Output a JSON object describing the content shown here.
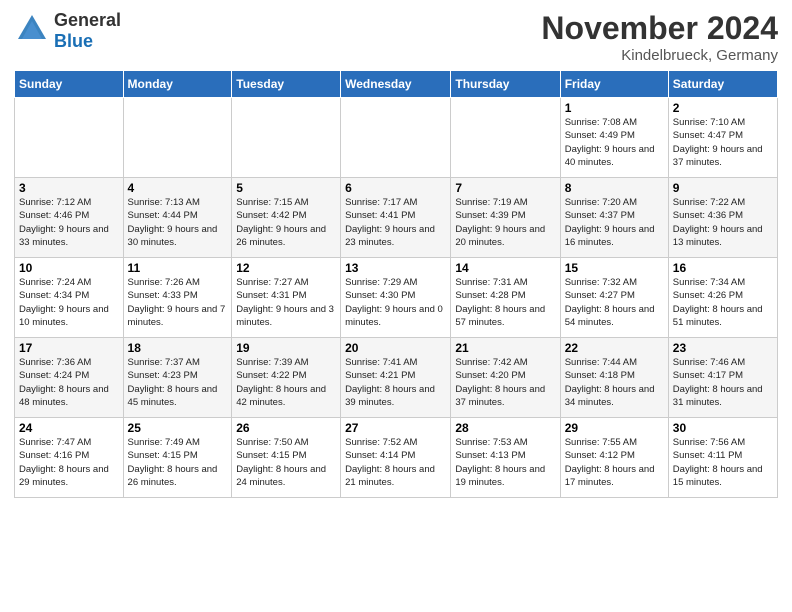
{
  "header": {
    "logo_general": "General",
    "logo_blue": "Blue",
    "month_title": "November 2024",
    "location": "Kindelbrueck, Germany"
  },
  "days_of_week": [
    "Sunday",
    "Monday",
    "Tuesday",
    "Wednesday",
    "Thursday",
    "Friday",
    "Saturday"
  ],
  "weeks": [
    [
      {
        "day": "",
        "sunrise": "",
        "sunset": "",
        "daylight": ""
      },
      {
        "day": "",
        "sunrise": "",
        "sunset": "",
        "daylight": ""
      },
      {
        "day": "",
        "sunrise": "",
        "sunset": "",
        "daylight": ""
      },
      {
        "day": "",
        "sunrise": "",
        "sunset": "",
        "daylight": ""
      },
      {
        "day": "",
        "sunrise": "",
        "sunset": "",
        "daylight": ""
      },
      {
        "day": "1",
        "sunrise": "Sunrise: 7:08 AM",
        "sunset": "Sunset: 4:49 PM",
        "daylight": "Daylight: 9 hours and 40 minutes."
      },
      {
        "day": "2",
        "sunrise": "Sunrise: 7:10 AM",
        "sunset": "Sunset: 4:47 PM",
        "daylight": "Daylight: 9 hours and 37 minutes."
      }
    ],
    [
      {
        "day": "3",
        "sunrise": "Sunrise: 7:12 AM",
        "sunset": "Sunset: 4:46 PM",
        "daylight": "Daylight: 9 hours and 33 minutes."
      },
      {
        "day": "4",
        "sunrise": "Sunrise: 7:13 AM",
        "sunset": "Sunset: 4:44 PM",
        "daylight": "Daylight: 9 hours and 30 minutes."
      },
      {
        "day": "5",
        "sunrise": "Sunrise: 7:15 AM",
        "sunset": "Sunset: 4:42 PM",
        "daylight": "Daylight: 9 hours and 26 minutes."
      },
      {
        "day": "6",
        "sunrise": "Sunrise: 7:17 AM",
        "sunset": "Sunset: 4:41 PM",
        "daylight": "Daylight: 9 hours and 23 minutes."
      },
      {
        "day": "7",
        "sunrise": "Sunrise: 7:19 AM",
        "sunset": "Sunset: 4:39 PM",
        "daylight": "Daylight: 9 hours and 20 minutes."
      },
      {
        "day": "8",
        "sunrise": "Sunrise: 7:20 AM",
        "sunset": "Sunset: 4:37 PM",
        "daylight": "Daylight: 9 hours and 16 minutes."
      },
      {
        "day": "9",
        "sunrise": "Sunrise: 7:22 AM",
        "sunset": "Sunset: 4:36 PM",
        "daylight": "Daylight: 9 hours and 13 minutes."
      }
    ],
    [
      {
        "day": "10",
        "sunrise": "Sunrise: 7:24 AM",
        "sunset": "Sunset: 4:34 PM",
        "daylight": "Daylight: 9 hours and 10 minutes."
      },
      {
        "day": "11",
        "sunrise": "Sunrise: 7:26 AM",
        "sunset": "Sunset: 4:33 PM",
        "daylight": "Daylight: 9 hours and 7 minutes."
      },
      {
        "day": "12",
        "sunrise": "Sunrise: 7:27 AM",
        "sunset": "Sunset: 4:31 PM",
        "daylight": "Daylight: 9 hours and 3 minutes."
      },
      {
        "day": "13",
        "sunrise": "Sunrise: 7:29 AM",
        "sunset": "Sunset: 4:30 PM",
        "daylight": "Daylight: 9 hours and 0 minutes."
      },
      {
        "day": "14",
        "sunrise": "Sunrise: 7:31 AM",
        "sunset": "Sunset: 4:28 PM",
        "daylight": "Daylight: 8 hours and 57 minutes."
      },
      {
        "day": "15",
        "sunrise": "Sunrise: 7:32 AM",
        "sunset": "Sunset: 4:27 PM",
        "daylight": "Daylight: 8 hours and 54 minutes."
      },
      {
        "day": "16",
        "sunrise": "Sunrise: 7:34 AM",
        "sunset": "Sunset: 4:26 PM",
        "daylight": "Daylight: 8 hours and 51 minutes."
      }
    ],
    [
      {
        "day": "17",
        "sunrise": "Sunrise: 7:36 AM",
        "sunset": "Sunset: 4:24 PM",
        "daylight": "Daylight: 8 hours and 48 minutes."
      },
      {
        "day": "18",
        "sunrise": "Sunrise: 7:37 AM",
        "sunset": "Sunset: 4:23 PM",
        "daylight": "Daylight: 8 hours and 45 minutes."
      },
      {
        "day": "19",
        "sunrise": "Sunrise: 7:39 AM",
        "sunset": "Sunset: 4:22 PM",
        "daylight": "Daylight: 8 hours and 42 minutes."
      },
      {
        "day": "20",
        "sunrise": "Sunrise: 7:41 AM",
        "sunset": "Sunset: 4:21 PM",
        "daylight": "Daylight: 8 hours and 39 minutes."
      },
      {
        "day": "21",
        "sunrise": "Sunrise: 7:42 AM",
        "sunset": "Sunset: 4:20 PM",
        "daylight": "Daylight: 8 hours and 37 minutes."
      },
      {
        "day": "22",
        "sunrise": "Sunrise: 7:44 AM",
        "sunset": "Sunset: 4:18 PM",
        "daylight": "Daylight: 8 hours and 34 minutes."
      },
      {
        "day": "23",
        "sunrise": "Sunrise: 7:46 AM",
        "sunset": "Sunset: 4:17 PM",
        "daylight": "Daylight: 8 hours and 31 minutes."
      }
    ],
    [
      {
        "day": "24",
        "sunrise": "Sunrise: 7:47 AM",
        "sunset": "Sunset: 4:16 PM",
        "daylight": "Daylight: 8 hours and 29 minutes."
      },
      {
        "day": "25",
        "sunrise": "Sunrise: 7:49 AM",
        "sunset": "Sunset: 4:15 PM",
        "daylight": "Daylight: 8 hours and 26 minutes."
      },
      {
        "day": "26",
        "sunrise": "Sunrise: 7:50 AM",
        "sunset": "Sunset: 4:15 PM",
        "daylight": "Daylight: 8 hours and 24 minutes."
      },
      {
        "day": "27",
        "sunrise": "Sunrise: 7:52 AM",
        "sunset": "Sunset: 4:14 PM",
        "daylight": "Daylight: 8 hours and 21 minutes."
      },
      {
        "day": "28",
        "sunrise": "Sunrise: 7:53 AM",
        "sunset": "Sunset: 4:13 PM",
        "daylight": "Daylight: 8 hours and 19 minutes."
      },
      {
        "day": "29",
        "sunrise": "Sunrise: 7:55 AM",
        "sunset": "Sunset: 4:12 PM",
        "daylight": "Daylight: 8 hours and 17 minutes."
      },
      {
        "day": "30",
        "sunrise": "Sunrise: 7:56 AM",
        "sunset": "Sunset: 4:11 PM",
        "daylight": "Daylight: 8 hours and 15 minutes."
      }
    ]
  ]
}
